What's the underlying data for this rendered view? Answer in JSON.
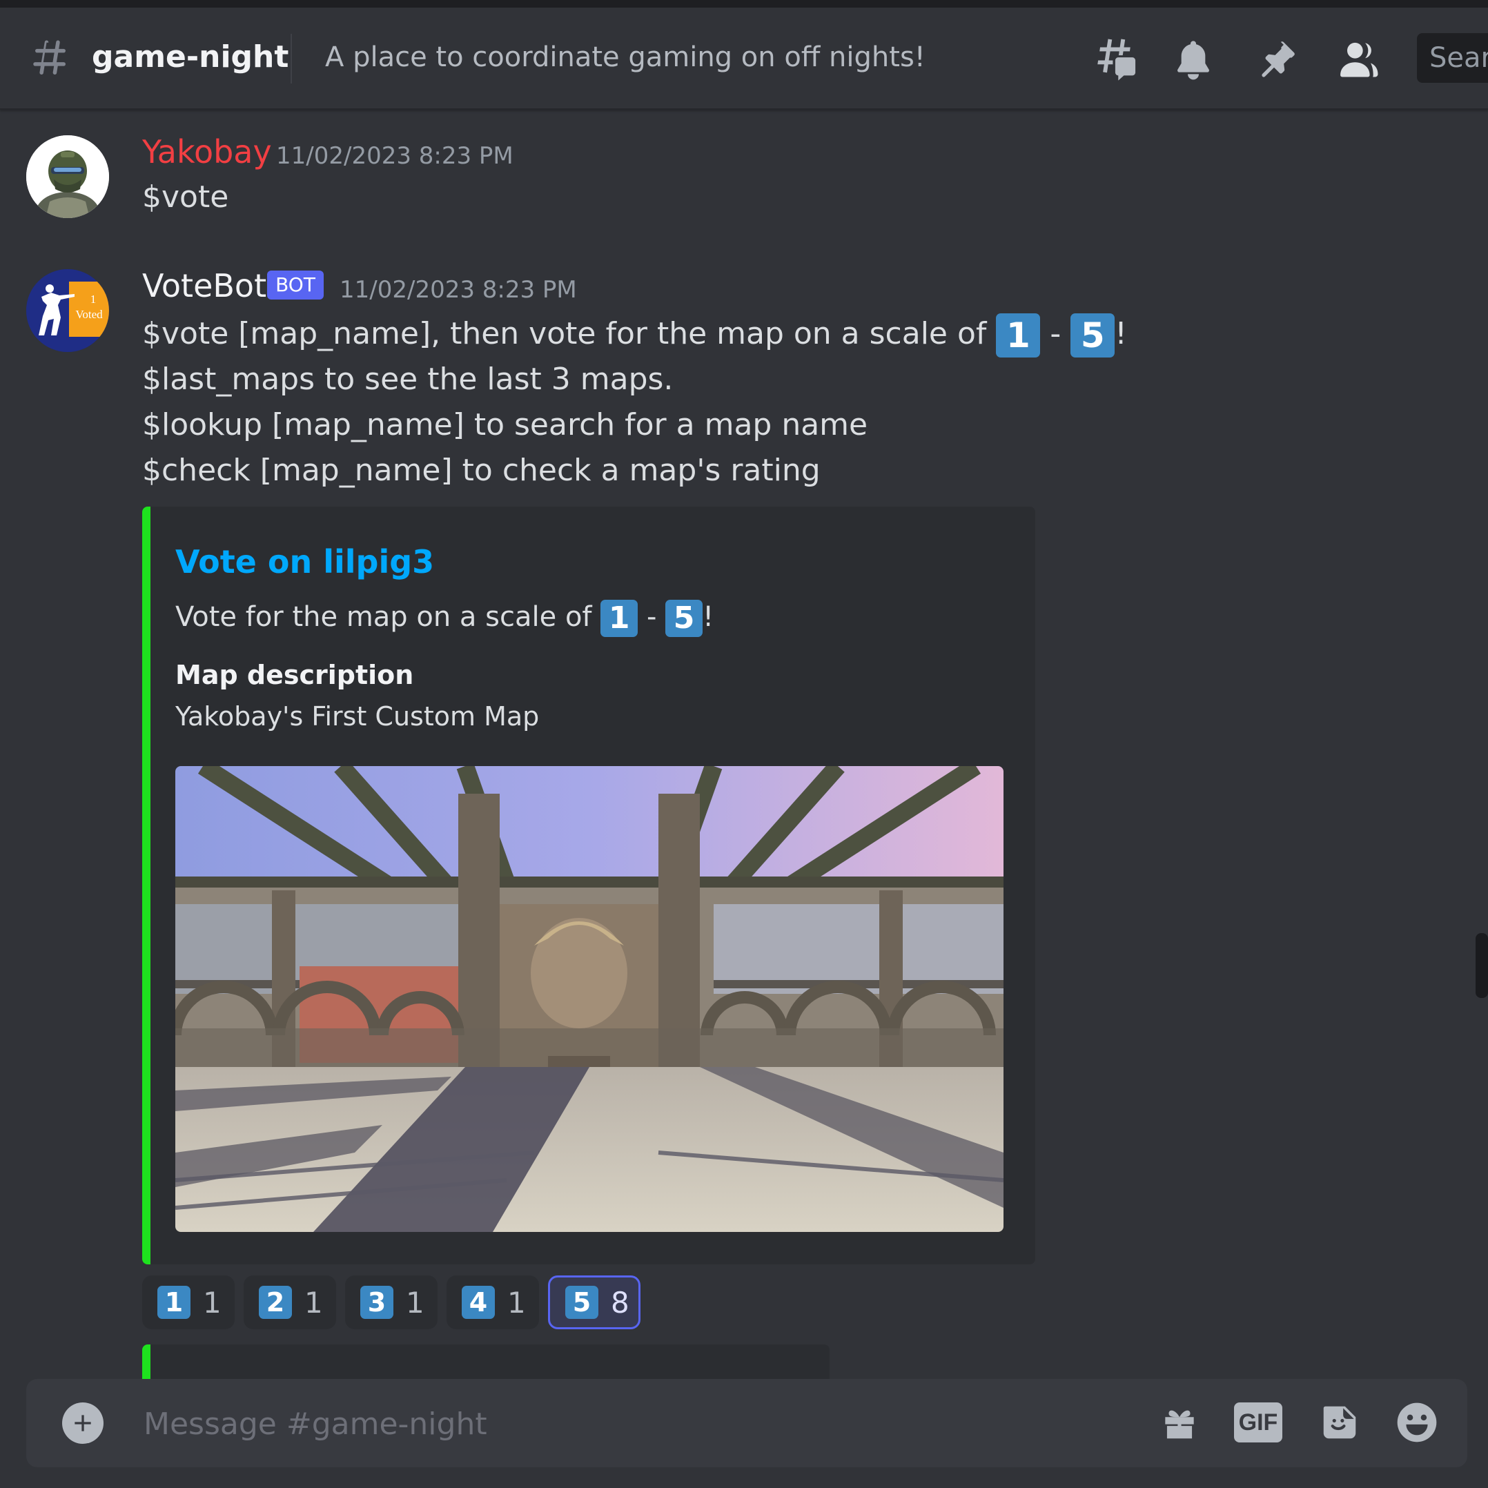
{
  "header": {
    "channel_name": "game-night",
    "topic": "A place to coordinate gaming on off nights!",
    "search_placeholder": "Sear"
  },
  "messages": [
    {
      "author": "Yakobay",
      "author_color": "#f23f43",
      "timestamp": "11/02/2023 8:23 PM",
      "content": "$vote"
    },
    {
      "author": "VoteBot",
      "author_color": "#f2f3f5",
      "bot_tag": "BOT",
      "timestamp": "11/02/2023 8:23 PM",
      "lines": {
        "line1_text": "$vote [map_name], then vote for the map on a scale of",
        "key_min": "1",
        "dash": "-",
        "key_max": "5",
        "bang": "!",
        "line2": "$last_maps to see the last 3 maps.",
        "line3": "$lookup [map_name] to search for a map name",
        "line4": "$check [map_name] to check a map's rating"
      },
      "embed": {
        "title": "Vote on lilpig3",
        "desc_text": "Vote for the map on a scale of",
        "key_min": "1",
        "dash": "-",
        "key_max": "5",
        "bang": "!",
        "field_name": "Map description",
        "field_value": "Yakobay's First Custom Map",
        "accent_color": "#1ee21e"
      },
      "reactions": [
        {
          "emoji": "1",
          "count": "1",
          "active": false
        },
        {
          "emoji": "2",
          "count": "1",
          "active": false
        },
        {
          "emoji": "3",
          "count": "1",
          "active": false
        },
        {
          "emoji": "4",
          "count": "1",
          "active": false
        },
        {
          "emoji": "5",
          "count": "8",
          "active": true
        }
      ]
    }
  ],
  "avatars": {
    "votebot_badge_line1": "1",
    "votebot_badge_line2": "Voted"
  },
  "composer": {
    "placeholder": "Message #game-night",
    "gif_label": "GIF"
  },
  "icons": {
    "header": [
      "threads-icon",
      "bell-icon",
      "pin-icon",
      "members-icon"
    ],
    "composer": [
      "add-icon",
      "gift-icon",
      "gif-icon",
      "sticker-icon",
      "emoji-icon"
    ]
  },
  "colors": {
    "background": "#313338",
    "embed_background": "#2b2d31",
    "link": "#00a8fc",
    "bot_tag": "#5865f2",
    "keycap": "#3b88c3"
  }
}
